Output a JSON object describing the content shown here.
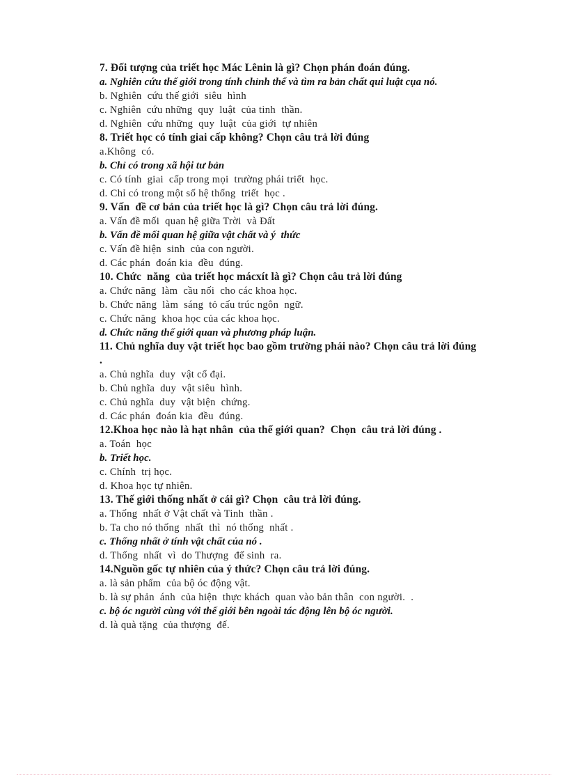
{
  "document": {
    "language": "vi",
    "page_background": "#ffffff",
    "text_color": "#1b1b1b",
    "footer_rule_color": "#f3c3cf",
    "blocks": [
      {
        "number": "7.",
        "stem": "7. Đối tượng của triết học Mác Lênin là gì? Chọn phán đoán đúng.",
        "options": [
          {
            "label": "a.",
            "text": "a. Nghiên cứu thế giới trong tính chỉnh thể và tìm ra bản chất qui luật cụa nó.",
            "style": "answer"
          },
          {
            "label": "b.",
            "text": "b. Nghiên  cứu thế giới  siêu  hình",
            "style": "plain"
          },
          {
            "label": "c.",
            "text": "c. Nghiên  cứu những  quy  luật  của tinh  thần.",
            "style": "plain"
          },
          {
            "label": "d.",
            "text": "d. Nghiên  cứu những  quy  luật  của giới  tự nhiên",
            "style": "plain"
          }
        ]
      },
      {
        "number": "8.",
        "stem": "8. Triết học có tính giai cấp không? Chọn câu trả lời đúng",
        "options": [
          {
            "label": "a.",
            "text": "a.Không  có.",
            "style": "plain"
          },
          {
            "label": "b.",
            "text": "b. Chỉ có trong xã hội tư bản",
            "style": "answer"
          },
          {
            "label": "c.",
            "text": "c. Có tính  giai  cấp trong mọi  trường phái triết  học.",
            "style": "plain"
          },
          {
            "label": "d.",
            "text": "d. Chỉ có trong một số hệ thống  triết  học .",
            "style": "plain"
          }
        ]
      },
      {
        "number": "9.",
        "stem": "9. Vấn  đề cơ bản của triết học là gì? Chọn câu trả lời đúng.",
        "options": [
          {
            "label": "a.",
            "text": "a. Vấn đề mối  quan hệ giữa Trời  và Đất",
            "style": "plain"
          },
          {
            "label": "b.",
            "text": "b. Vấn đề mối quan hệ giữa vật chất và ý  thức",
            "style": "answer"
          },
          {
            "label": "c.",
            "text": "c. Vấn đề hiện  sinh  của con người.",
            "style": "plain"
          },
          {
            "label": "d.",
            "text": "d. Các phán  đoán kia  đều  đúng.",
            "style": "plain"
          }
        ]
      },
      {
        "number": "10.",
        "stem": "10. Chức  năng  của triết học mácxít là gì? Chọn câu trả lời đúng",
        "options": [
          {
            "label": "a.",
            "text": "a. Chức năng  làm  cầu nối  cho các khoa học.",
            "style": "plain"
          },
          {
            "label": "b.",
            "text": "b. Chức năng  làm  sáng  tỏ cấu trúc ngôn  ngữ.",
            "style": "plain"
          },
          {
            "label": "c.",
            "text": "c. Chức năng  khoa học của các khoa học.",
            "style": "plain"
          },
          {
            "label": "d.",
            "text": "d. Chức năng thế giới quan và phương pháp luận.",
            "style": "answer"
          }
        ]
      },
      {
        "number": "11.",
        "stem": "11. Chủ nghĩa duy vật triết học bao gồm trường phái nào? Chọn câu trả lời đúng .",
        "options": [
          {
            "label": "a.",
            "text": "a. Chủ nghĩa  duy  vật cổ đại.",
            "style": "plain"
          },
          {
            "label": "b.",
            "text": "b. Chủ nghĩa  duy  vật siêu  hình.",
            "style": "plain"
          },
          {
            "label": "c.",
            "text": "c. Chủ nghĩa  duy  vật biện  chứng.",
            "style": "plain"
          },
          {
            "label": "d.",
            "text": "d. Các phán  đoán kia  đều  đúng.",
            "style": "plain"
          }
        ]
      },
      {
        "number": "12.",
        "stem": "12.Khoa học nào là hạt nhân  của thế giới quan?  Chọn  câu trả lời đúng .",
        "options": [
          {
            "label": "a.",
            "text": "a. Toán  học",
            "style": "plain"
          },
          {
            "label": "b.",
            "text": "b. Triết học.",
            "style": "answer"
          },
          {
            "label": "c.",
            "text": "c. Chính  trị học.",
            "style": "plain"
          },
          {
            "label": "d.",
            "text": "d. Khoa học tự nhiên.",
            "style": "plain"
          }
        ]
      },
      {
        "number": "13.",
        "stem": "13. Thế giới thống nhất ở cái gì? Chọn  câu trả lời đúng.",
        "options": [
          {
            "label": "a.",
            "text": "a. Thống  nhất ở Vật chất và Tinh  thần .",
            "style": "plain"
          },
          {
            "label": "b.",
            "text": "b. Ta cho nó thống  nhất  thì  nó thống  nhất .",
            "style": "plain"
          },
          {
            "label": "c.",
            "text": "c. Thống nhất ở tính vật chất của nó .",
            "style": "answer"
          },
          {
            "label": "d.",
            "text": "d. Thống  nhất  vì  do Thượng  đế sinh  ra.",
            "style": "plain"
          }
        ]
      },
      {
        "number": "14.",
        "stem": "14.Nguồn gốc tự nhiên của ý thức? Chọn câu trả lời đúng.",
        "options": [
          {
            "label": "a.",
            "text": "a. là sản phẩm  của bộ óc động vật.",
            "style": "plain"
          },
          {
            "label": "b.",
            "text": "b. là sự phản  ánh  của hiện  thực khách  quan vào bản thân  con người.  .",
            "style": "plain"
          },
          {
            "label": "c.",
            "text": "c. bộ óc người cùng với thế giới bên ngoài tác động lên bộ óc người.",
            "style": "answer"
          },
          {
            "label": "d.",
            "text": "d. là quà tặng  của thượng  đế.",
            "style": "plain"
          }
        ]
      }
    ]
  }
}
